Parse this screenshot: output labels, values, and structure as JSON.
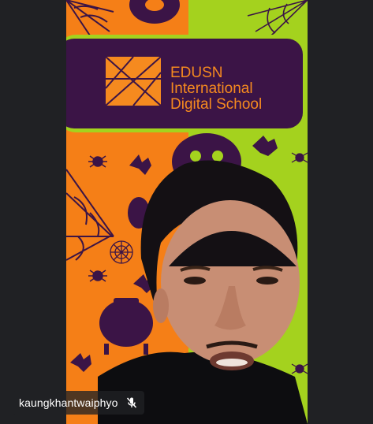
{
  "participant": {
    "name": "kaungkhantwaiphyo",
    "mic_state": "muted"
  },
  "background": {
    "banner_line1": "EDUSN",
    "banner_line2": "International",
    "banner_line3": "Digital School",
    "theme_colors": {
      "orange": "#F57F17",
      "lime": "#A4D21E",
      "purple": "#3B1446",
      "banner_text": "#F58A1F",
      "chip_bg": "#202124"
    }
  },
  "icons": [
    "mic-off-icon",
    "spider-web-icon",
    "spider-icon",
    "bat-icon",
    "pumpkin-icon",
    "cauldron-icon",
    "logo-icon"
  ]
}
